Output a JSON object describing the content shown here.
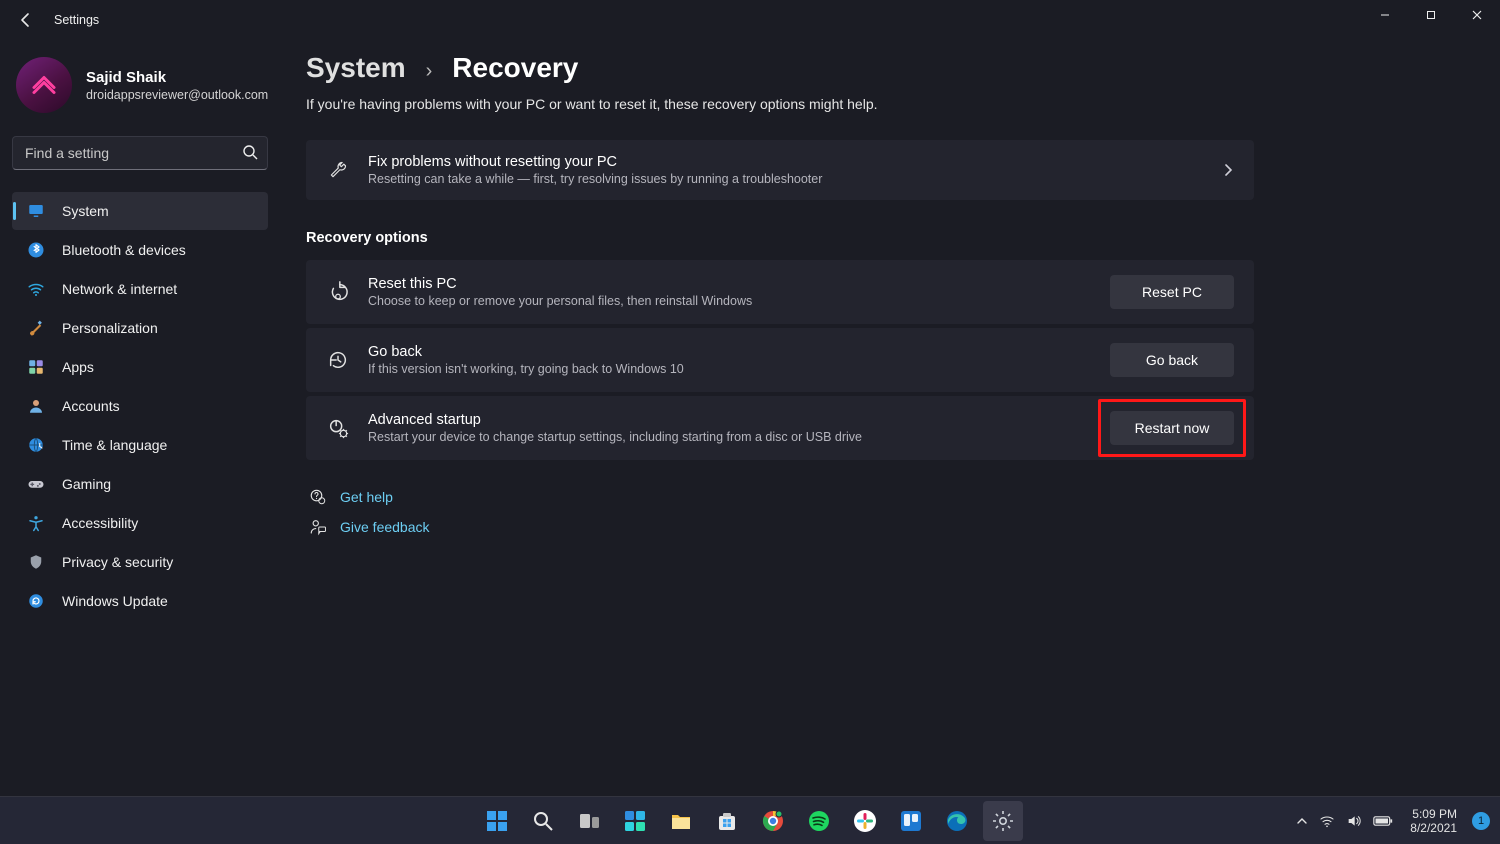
{
  "window": {
    "title": "Settings"
  },
  "user": {
    "name": "Sajid Shaik",
    "email": "droidappsreviewer@outlook.com"
  },
  "search": {
    "placeholder": "Find a setting"
  },
  "sidebar": {
    "items": [
      {
        "label": "System",
        "selected": true,
        "icon": "display"
      },
      {
        "label": "Bluetooth & devices",
        "selected": false,
        "icon": "bluetooth"
      },
      {
        "label": "Network & internet",
        "selected": false,
        "icon": "wifi"
      },
      {
        "label": "Personalization",
        "selected": false,
        "icon": "brush"
      },
      {
        "label": "Apps",
        "selected": false,
        "icon": "apps"
      },
      {
        "label": "Accounts",
        "selected": false,
        "icon": "person"
      },
      {
        "label": "Time & language",
        "selected": false,
        "icon": "globe"
      },
      {
        "label": "Gaming",
        "selected": false,
        "icon": "gamepad"
      },
      {
        "label": "Accessibility",
        "selected": false,
        "icon": "accessibility"
      },
      {
        "label": "Privacy & security",
        "selected": false,
        "icon": "shield"
      },
      {
        "label": "Windows Update",
        "selected": false,
        "icon": "update"
      }
    ]
  },
  "breadcrumb": {
    "parent": "System",
    "page": "Recovery"
  },
  "subtitle": "If you're having problems with your PC or want to reset it, these recovery options might help.",
  "fixcard": {
    "title": "Fix problems without resetting your PC",
    "desc": "Resetting can take a while — first, try resolving issues by running a troubleshooter"
  },
  "section_title": "Recovery options",
  "rows": {
    "reset": {
      "title": "Reset this PC",
      "desc": "Choose to keep or remove your personal files, then reinstall Windows",
      "button": "Reset PC"
    },
    "goback": {
      "title": "Go back",
      "desc": "If this version isn't working, try going back to Windows 10",
      "button": "Go back"
    },
    "advanced": {
      "title": "Advanced startup",
      "desc": "Restart your device to change startup settings, including starting from a disc or USB drive",
      "button": "Restart now"
    }
  },
  "help": {
    "get_help": "Get help",
    "feedback": "Give feedback"
  },
  "tray": {
    "time": "5:09 PM",
    "date": "8/2/2021",
    "notif": "1"
  },
  "highlight": {
    "target": "restart-now-button"
  }
}
